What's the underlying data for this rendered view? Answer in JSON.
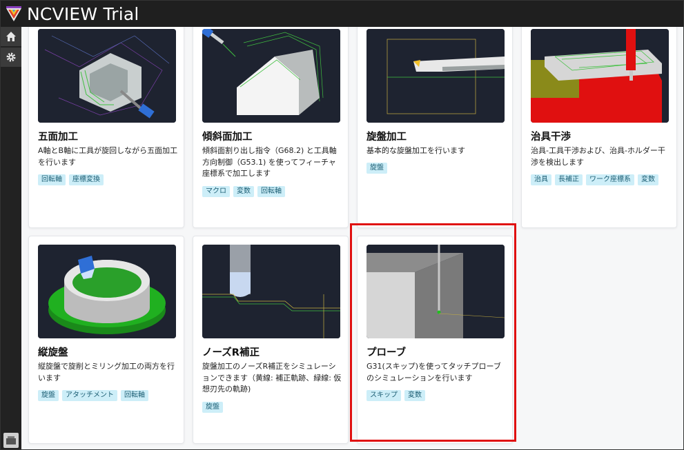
{
  "app": {
    "title": "NCVIEW Trial"
  },
  "sidebar": {
    "icons": [
      "home-icon",
      "gear-icon"
    ],
    "bottom_icon": "folder-icon"
  },
  "cards": [
    {
      "title": "五面加工",
      "desc": "A軸とB軸に工具が旋回しながら五面加工を行います",
      "tags": [
        "回転軸",
        "座標変換"
      ]
    },
    {
      "title": "傾斜面加工",
      "desc": "傾斜面割り出し指令（G68.2) と工具軸方向制御（G53.1) を使ってフィーチャ座標系で加工します",
      "tags": [
        "マクロ",
        "変数",
        "回転軸"
      ]
    },
    {
      "title": "旋盤加工",
      "desc": "基本的な旋盤加工を行います",
      "tags": [
        "旋盤"
      ]
    },
    {
      "title": "治具干渉",
      "desc": "治具-工具干渉および、治具-ホルダー干渉を検出します",
      "tags": [
        "治具",
        "長補正",
        "ワーク座標系",
        "変数"
      ]
    },
    {
      "title": "縦旋盤",
      "desc": "縦旋盤で旋削とミリング加工の両方を行います",
      "tags": [
        "旋盤",
        "アタッチメント",
        "回転軸"
      ]
    },
    {
      "title": "ノーズR補正",
      "desc": "旋盤加工のノーズR補正をシミュレーションできます（黄線: 補正軌跡、緑線: 仮想刃先の軌跡)",
      "tags": [
        "旋盤"
      ]
    },
    {
      "title": "プローブ",
      "desc": "G31(スキップ)を使ってタッチプローブのシミュレーションを行います",
      "tags": [
        "スキップ",
        "変数"
      ]
    }
  ],
  "colors": {
    "titlebar": "#1f1f1f",
    "tag_bg": "#cdeef8",
    "tag_text": "#1b5d73",
    "highlight": "#e01010",
    "thumb_bg": "#1e2330"
  }
}
